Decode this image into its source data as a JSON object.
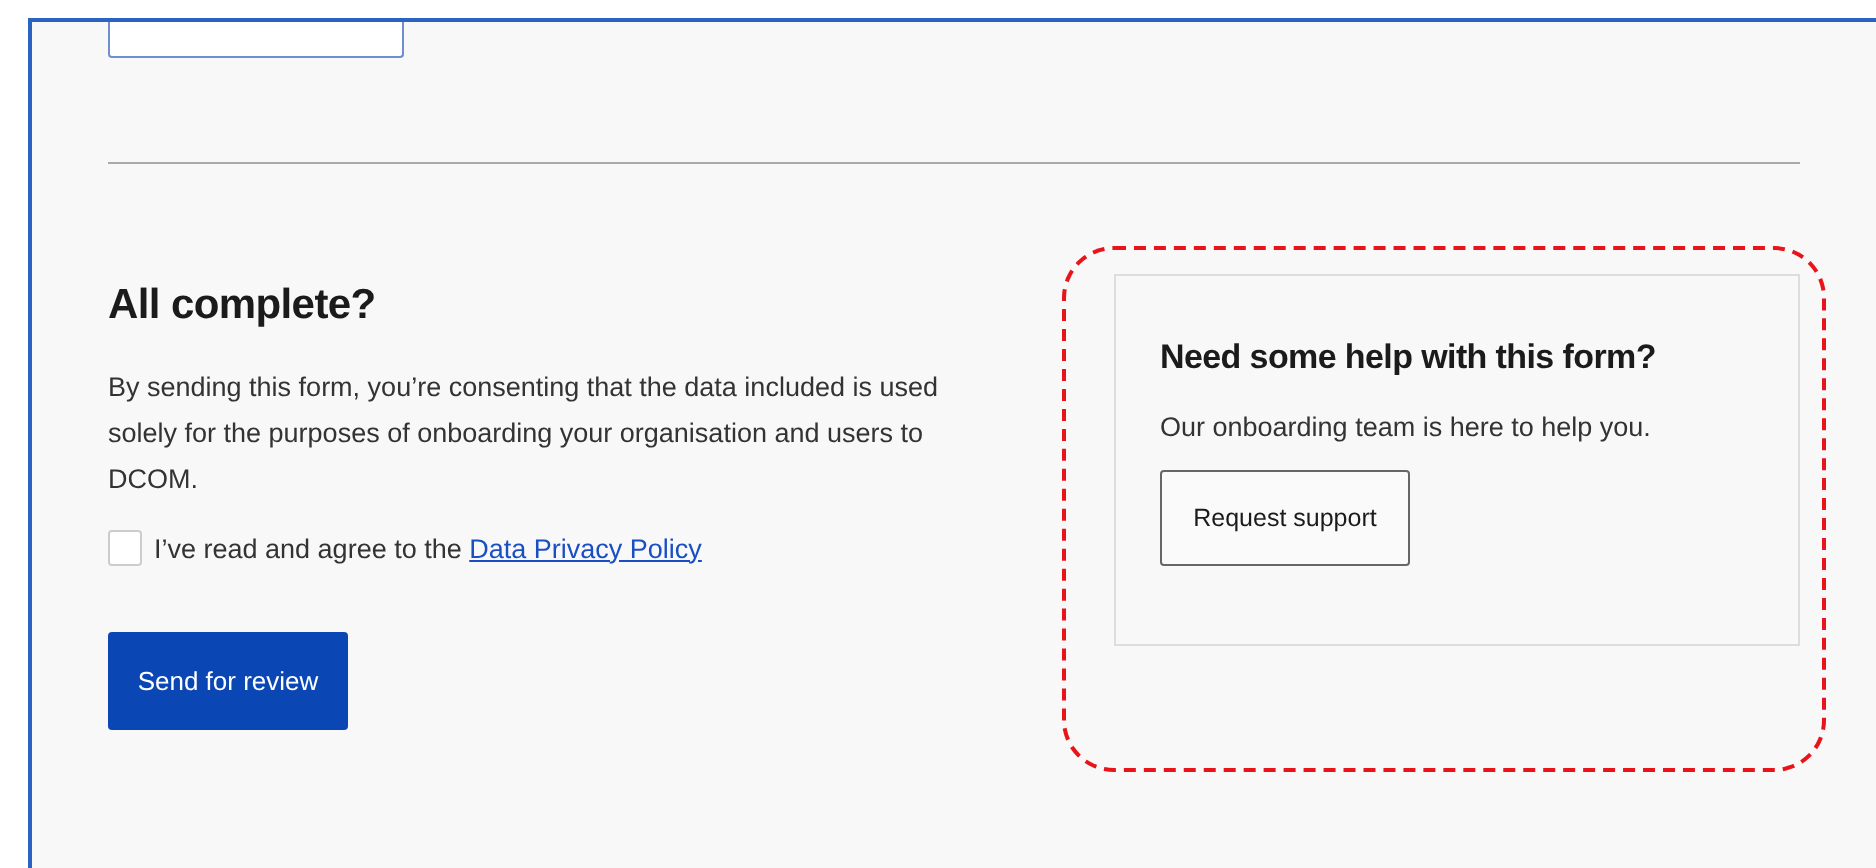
{
  "top_field": {
    "kind": "input"
  },
  "consent": {
    "heading": "All complete?",
    "text": "By sending this form, you’re consenting that the data included is used solely for the purposes of onboarding your organisation and users to DCOM.",
    "checkbox": {
      "label": "I’ve read and agree to the ",
      "link": "Data Privacy Policy",
      "checked": false
    },
    "button": "Send for review"
  },
  "help_card": {
    "title": "Need some help with this form?",
    "text": "Our onboarding team is here to help you.",
    "button": "Request support",
    "highlighted": true
  }
}
